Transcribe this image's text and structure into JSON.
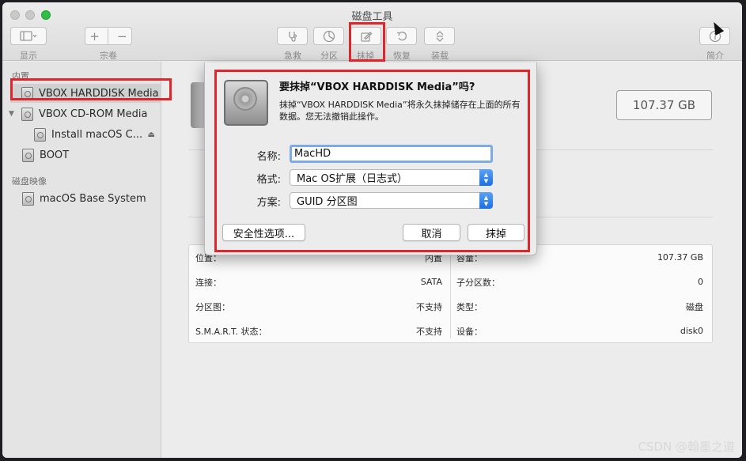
{
  "window": {
    "title": "磁盘工具"
  },
  "toolbar": {
    "display_label": "显示",
    "volume_label": "宗卷",
    "volume_add": "+",
    "volume_remove": "−",
    "firstaid_label": "急救",
    "partition_label": "分区",
    "erase_label": "抹掉",
    "restore_label": "恢复",
    "mount_label": "装载",
    "info_label": "简介"
  },
  "sidebar": {
    "internal_header": "内置",
    "disk_images_header": "磁盘映像",
    "items": [
      {
        "label": "VBOX HARDDISK Media",
        "selected": true
      },
      {
        "label": "VBOX CD-ROM Media",
        "expanded": true
      },
      {
        "label": "Install macOS C..."
      },
      {
        "label": "BOOT"
      },
      {
        "label": "macOS Base System"
      }
    ]
  },
  "main": {
    "capacity": "107.37 GB",
    "info_left": [
      {
        "key": "位置：",
        "value": "内置"
      },
      {
        "key": "连接：",
        "value": "SATA"
      },
      {
        "key": "分区图：",
        "value": "不支持"
      },
      {
        "key": "S.M.A.R.T. 状态：",
        "value": "不支持"
      }
    ],
    "info_right": [
      {
        "key": "容量：",
        "value": "107.37 GB"
      },
      {
        "key": "子分区数：",
        "value": "0"
      },
      {
        "key": "类型：",
        "value": "磁盘"
      },
      {
        "key": "设备：",
        "value": "disk0"
      }
    ]
  },
  "dialog": {
    "title": "要抹掉“VBOX HARDDISK Media”吗?",
    "message": "抹掉“VBOX HARDDISK Media”将永久抹掉储存在上面的所有数据。您无法撤销此操作。",
    "name_label": "名称:",
    "name_value": "MacHD",
    "format_label": "格式:",
    "format_value": "Mac OS扩展（日志式）",
    "scheme_label": "方案:",
    "scheme_value": "GUID 分区图",
    "security_button": "安全性选项...",
    "cancel_button": "取消",
    "erase_button": "抹掉"
  },
  "watermark": "CSDN @翰墨之道",
  "colors": {
    "highlight": "#e0262b",
    "accent": "#1a6fe6",
    "focus_ring": "#7cabe8"
  }
}
